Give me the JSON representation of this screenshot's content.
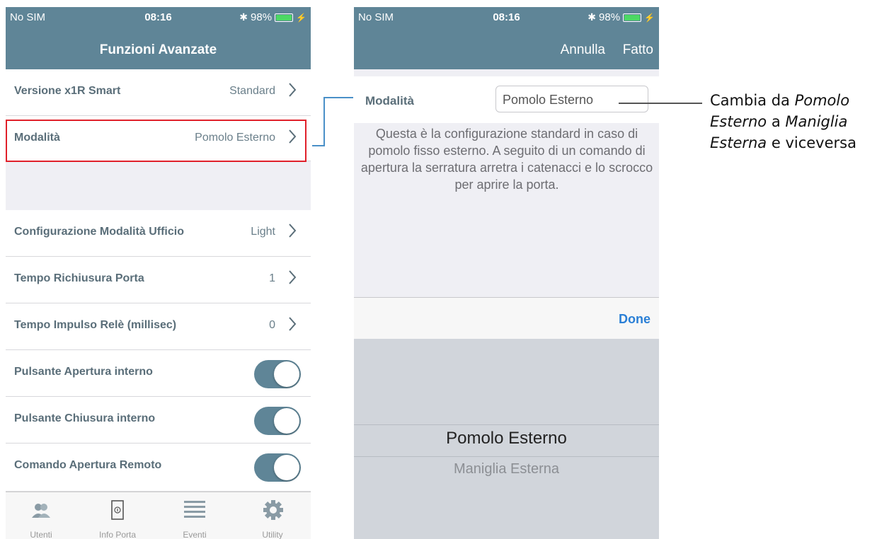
{
  "left_screen": {
    "status_bar": {
      "carrier": "No SIM",
      "time": "08:16",
      "battery": "98%",
      "battery_level": 0.98
    },
    "title": "Funzioni Avanzate",
    "rows": [
      {
        "label": "Versione x1R Smart",
        "value": "Standard"
      },
      {
        "label": "Modalità",
        "value": "Pomolo Esterno"
      }
    ],
    "settings": [
      {
        "label": "Configurazione Modalità Ufficio",
        "value": "Light"
      },
      {
        "label": "Tempo Richiusura Porta",
        "value": "1"
      },
      {
        "label": "Tempo Impulso Relè (millisec)",
        "value": "0"
      }
    ],
    "toggles": [
      {
        "label": "Pulsante Apertura interno",
        "on": true
      },
      {
        "label": "Pulsante Chiusura interno",
        "on": true
      },
      {
        "label": "Comando Apertura Remoto",
        "on": true
      }
    ],
    "tabs": [
      {
        "label": "Utenti",
        "icon": "users-icon"
      },
      {
        "label": "Info Porta",
        "icon": "door-icon",
        "active": true
      },
      {
        "label": "Eventi",
        "icon": "list-icon"
      },
      {
        "label": "Utility",
        "icon": "gear-icon"
      }
    ]
  },
  "right_screen": {
    "status_bar": {
      "carrier": "No SIM",
      "time": "08:16",
      "battery": "98%",
      "battery_level": 0.98
    },
    "nav": {
      "cancel": "Annulla",
      "done": "Fatto"
    },
    "field": {
      "label": "Modalità",
      "value": "Pomolo Esterno"
    },
    "description": "Questa è la configurazione standard in caso di pomolo fisso esterno. A seguito di un comando di apertura la serratura arretra i catenacci e lo scrocco per aprire la porta.",
    "toolbar_done": "Done",
    "picker": {
      "selected": "Pomolo Esterno",
      "next": "Maniglia Esterna"
    }
  },
  "callout": {
    "prefix": "Cambia da ",
    "from": "Pomolo Esterno",
    "middle": " a ",
    "to": "Maniglia Esterna",
    "suffix": " e viceversa"
  },
  "colors": {
    "nav": "#5f8597",
    "highlight": "#e0202a",
    "connector": "#4a90c8",
    "done": "#2a7fd6"
  }
}
